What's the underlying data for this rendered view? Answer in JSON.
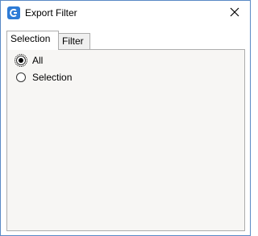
{
  "window": {
    "title": "Export Filter",
    "border_color": "#5a8ac6",
    "app_icon": "app-logo-icon",
    "close_icon": "close-icon"
  },
  "tabs": [
    {
      "label": "Selection",
      "active": true
    },
    {
      "label": "Filter",
      "active": false
    }
  ],
  "selection_panel": {
    "options": [
      {
        "label": "All",
        "checked": true
      },
      {
        "label": "Selection",
        "checked": false
      }
    ]
  },
  "colors": {
    "panel_bg": "#f7f6f4",
    "icon_blue": "#2e7bd6"
  }
}
